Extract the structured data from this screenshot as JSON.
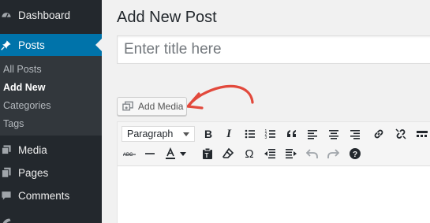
{
  "sidebar": {
    "items": [
      {
        "label": "Dashboard",
        "icon": "dashboard-icon"
      },
      {
        "label": "Posts",
        "icon": "pin-icon"
      },
      {
        "label": "Media",
        "icon": "media-icon"
      },
      {
        "label": "Pages",
        "icon": "pages-icon"
      },
      {
        "label": "Comments",
        "icon": "comment-icon"
      }
    ],
    "submenu": [
      "All Posts",
      "Add New",
      "Categories",
      "Tags"
    ]
  },
  "main": {
    "title": "Add New Post",
    "title_placeholder": "Enter title here",
    "add_media_label": "Add Media"
  },
  "toolbar": {
    "format_value": "Paragraph",
    "row1": [
      "bold-icon",
      "italic-icon",
      "bullet-list-icon",
      "numbered-list-icon",
      "blockquote-icon",
      "align-left-icon",
      "align-center-icon",
      "align-right-icon",
      "insert-link-icon",
      "unlink-icon",
      "toolbar-toggle-icon"
    ],
    "row2": [
      "strikethrough-icon",
      "horizontal-line-icon",
      "text-color-icon",
      "paste-text-icon",
      "clear-formatting-icon",
      "special-character-icon",
      "outdent-icon",
      "indent-icon",
      "undo-icon",
      "redo-icon",
      "help-icon"
    ]
  },
  "colors": {
    "sidebar_bg": "#23282d",
    "accent": "#0073aa",
    "annotation_arrow": "#e2493c"
  }
}
